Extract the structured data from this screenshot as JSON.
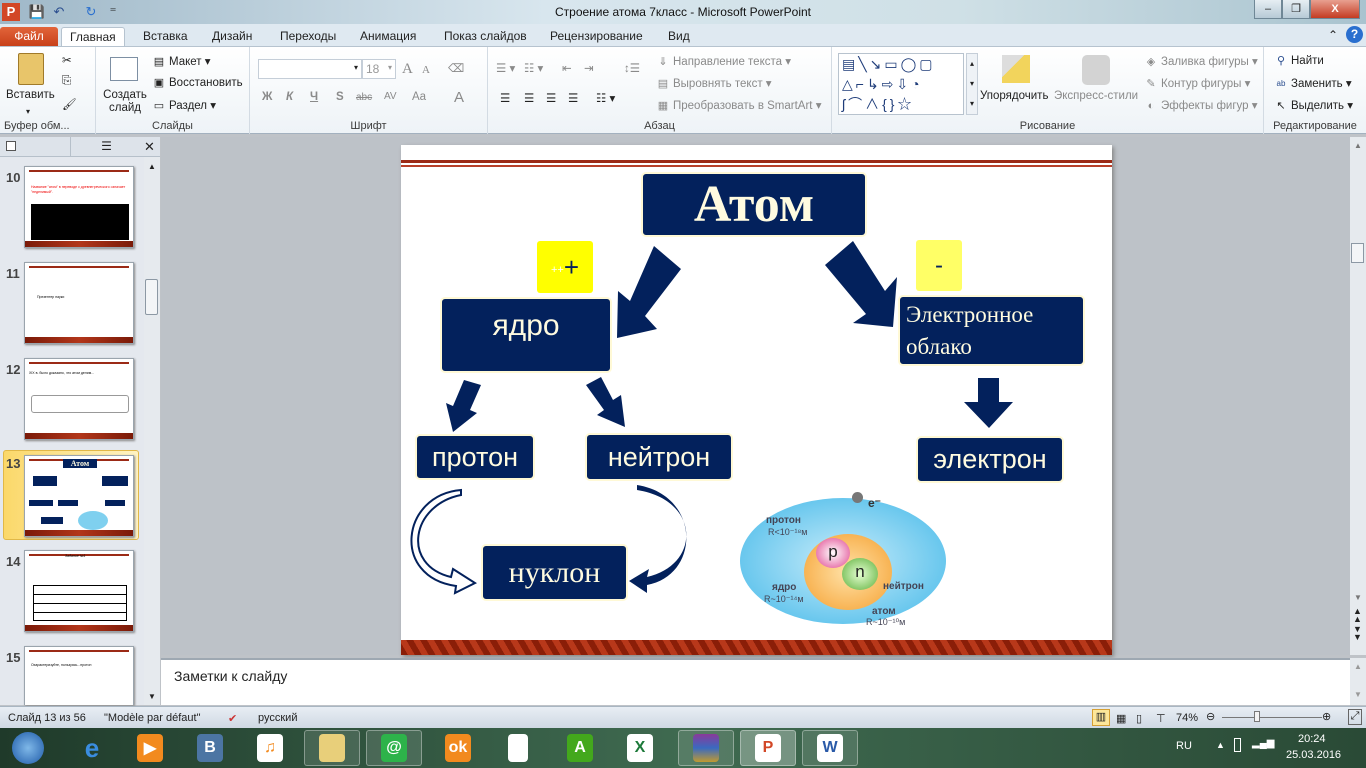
{
  "window": {
    "title": "Строение атома 7класс  -  Microsoft PowerPoint",
    "minimize": "–",
    "restore": "❐",
    "close": "X"
  },
  "tabs": [
    "Файл",
    "Главная",
    "Вставка",
    "Дизайн",
    "Переходы",
    "Анимация",
    "Показ слайдов",
    "Рецензирование",
    "Вид"
  ],
  "ribbon": {
    "clipboard": {
      "paste": "Вставить",
      "label": "Буфер обм..."
    },
    "slides": {
      "new_slide": "Создать слайд",
      "layout": "Макет",
      "reset": "Восстановить",
      "section": "Раздел",
      "label": "Слайды"
    },
    "font": {
      "font_name": "",
      "font_size": "18",
      "bold": "Ж",
      "italic": "К",
      "underline": "Ч",
      "shadow": "S",
      "strike": "abc",
      "spacing": "AV",
      "case": "Aa",
      "color": "A",
      "grow": "A",
      "shrink": "A",
      "label": "Шрифт"
    },
    "paragraph": {
      "text_direction": "Направление текста",
      "align_text": "Выровнять текст",
      "smartart": "Преобразовать в SmartArt",
      "label": "Абзац"
    },
    "drawing": {
      "arrange": "Упорядочить",
      "quick_styles": "Экспресс-стили",
      "fill": "Заливка фигуры",
      "outline": "Контур фигуры",
      "effects": "Эффекты фигур",
      "label": "Рисование"
    },
    "editing": {
      "find": "Найти",
      "replace": "Заменить",
      "select": "Выделить",
      "label": "Редактирование"
    }
  },
  "thumbnails": [
    {
      "num": "10",
      "text": "Название \"атом\" в переводе с древнегреческого означает \"неделимый\"."
    },
    {
      "num": "11",
      "text": "Презентер науки"
    },
    {
      "num": "12",
      "text": "XIX в. было доказано, что атом делим..."
    },
    {
      "num": "13",
      "text": "Атом"
    },
    {
      "num": "14",
      "text": "Задание №1"
    },
    {
      "num": "15",
      "text": "Охарактеризуйте, пользуясь...протон"
    }
  ],
  "slide": {
    "atom": "Атом",
    "plus": "+",
    "plus_small": "++",
    "minus": "-",
    "nucleus": "ядро",
    "cloud": "Электронное облако",
    "proton": "протон",
    "neutron": "нейтрон",
    "electron": "электрон",
    "nucleon": "нуклон",
    "diagram": {
      "e": "e⁻",
      "proton": "протон",
      "proton_r": "R<10⁻¹⁸м",
      "p": "p",
      "n": "n",
      "nucleus": "ядро",
      "nucleus_r": "R~10⁻¹⁴м",
      "neutron": "нейтрон",
      "atom": "атом",
      "atom_r": "R~10⁻¹⁰м"
    }
  },
  "notes": {
    "placeholder": "Заметки к слайду"
  },
  "status": {
    "slide": "Слайд 13 из 56",
    "theme": "\"Modèle par défaut\"",
    "language": "русский",
    "zoom": "74%"
  },
  "taskbar": {
    "lang": "RU",
    "time": "20:24",
    "date": "25.03.2016"
  }
}
